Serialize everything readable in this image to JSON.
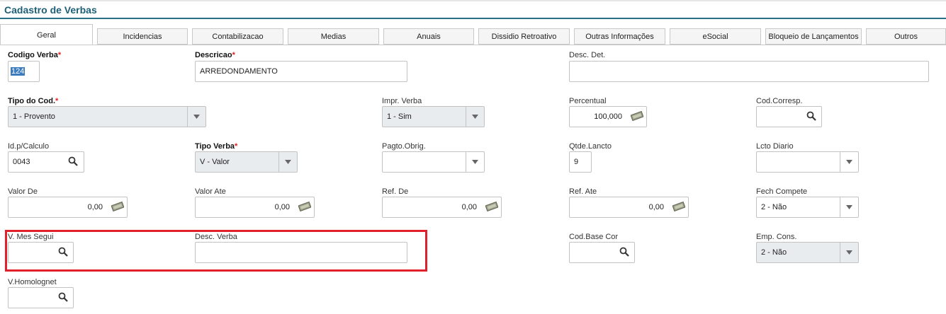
{
  "page": {
    "title": "Cadastro de Verbas"
  },
  "tabs": [
    {
      "label": "Geral",
      "active": true
    },
    {
      "label": "Incidencias"
    },
    {
      "label": "Contabilizacao"
    },
    {
      "label": "Medias"
    },
    {
      "label": "Anuais"
    },
    {
      "label": "Dissidio Retroativo"
    },
    {
      "label": "Outras Informações"
    },
    {
      "label": "eSocial"
    },
    {
      "label": "Bloqueio de Lançamentos"
    },
    {
      "label": "Outros"
    }
  ],
  "form": {
    "required_mark": "*",
    "codigo_verba": {
      "label": "Codigo Verba",
      "value": "124"
    },
    "descricao": {
      "label": "Descricao",
      "value": "ARREDONDAMENTO"
    },
    "desc_det": {
      "label": "Desc. Det.",
      "value": ""
    },
    "tipo_cod": {
      "label": "Tipo do Cod.",
      "value": "1 - Provento"
    },
    "impr_verba": {
      "label": "Impr. Verba",
      "value": "1 - Sim"
    },
    "percentual": {
      "label": "Percentual",
      "value": "100,000"
    },
    "cod_corresp": {
      "label": "Cod.Corresp.",
      "value": ""
    },
    "id_calculo": {
      "label": "Id.p/Calculo",
      "value": "0043"
    },
    "tipo_verba": {
      "label": "Tipo Verba",
      "value": "V - Valor"
    },
    "pagto_obrig": {
      "label": "Pagto.Obrig.",
      "value": ""
    },
    "qtde_lancto": {
      "label": "Qtde.Lancto",
      "value": "9"
    },
    "lcto_diario": {
      "label": "Lcto Diario",
      "value": ""
    },
    "valor_de": {
      "label": "Valor De",
      "value": "0,00"
    },
    "valor_ate": {
      "label": "Valor Ate",
      "value": "0,00"
    },
    "ref_de": {
      "label": "Ref. De",
      "value": "0,00"
    },
    "ref_ate": {
      "label": "Ref. Ate",
      "value": "0,00"
    },
    "fech_compete": {
      "label": "Fech Compete",
      "value": "2 - Não"
    },
    "v_mes_segui": {
      "label": "V. Mes Segui",
      "value": ""
    },
    "desc_verba": {
      "label": "Desc. Verba",
      "value": ""
    },
    "cod_base_cor": {
      "label": "Cod.Base Cor",
      "value": ""
    },
    "emp_cons": {
      "label": "Emp. Cons.",
      "value": "2 - Não"
    },
    "v_homolognet": {
      "label": "V.Homolognet",
      "value": ""
    }
  },
  "colors": {
    "accent": "#1e5f78",
    "highlight": "#e0202a",
    "required": "#e02020"
  },
  "icons": {
    "lookup": "search-icon",
    "dropdown": "chevron-down-icon",
    "numeric": "money-icon"
  }
}
